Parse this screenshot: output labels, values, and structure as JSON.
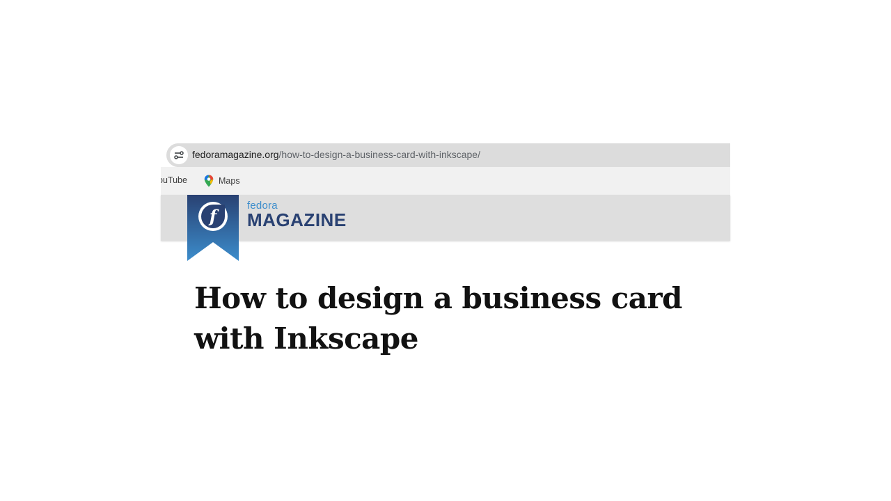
{
  "browser": {
    "address_bar": {
      "domain": "fedoramagazine.org",
      "path": "/how-to-design-a-business-card-with-inkscape/",
      "site_info_icon": "tune-icon"
    },
    "bookmarks": [
      {
        "label": "ouTube",
        "icon": "none"
      },
      {
        "label": "Maps",
        "icon": "maps-pin-icon"
      }
    ]
  },
  "site": {
    "brand_small": "fedora",
    "brand_big": "MAGAZINE",
    "logo": "fedora-logo-icon",
    "colors": {
      "ribbon_top": "#294172",
      "ribbon_bottom": "#3c8dcc",
      "brand_dark": "#294172",
      "brand_light": "#3c8dcc"
    }
  },
  "article": {
    "title": "How to design a business card with Inkscape"
  }
}
